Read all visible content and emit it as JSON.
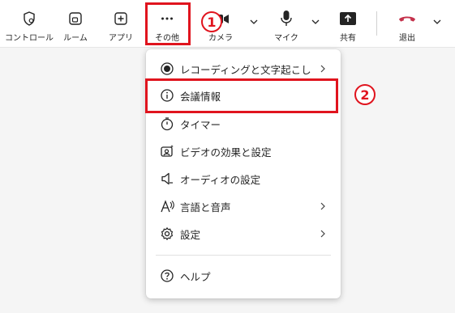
{
  "toolbar": {
    "controls_label": "コントロール",
    "room_label": "ルーム",
    "apps_label": "アプリ",
    "more_label": "その他",
    "camera_label": "カメラ",
    "mic_label": "マイク",
    "share_label": "共有",
    "leave_label": "退出",
    "leave_color": "#c4314b"
  },
  "menu": {
    "items": [
      {
        "label": "レコーディングと文字起こし",
        "icon": "record-icon"
      },
      {
        "label": "会議情報",
        "icon": "info-icon"
      },
      {
        "label": "タイマー",
        "icon": "timer-icon"
      },
      {
        "label": "ビデオの効果と設定",
        "icon": "video-effects-icon"
      },
      {
        "label": "オーディオの設定",
        "icon": "speaker-icon"
      },
      {
        "label": "言語と音声",
        "icon": "language-icon"
      },
      {
        "label": "設定",
        "icon": "gear-icon"
      },
      {
        "label": "ヘルプ",
        "icon": "help-icon"
      }
    ]
  },
  "annotations": {
    "step1": "1",
    "step2": "2",
    "color": "#e0141e"
  }
}
